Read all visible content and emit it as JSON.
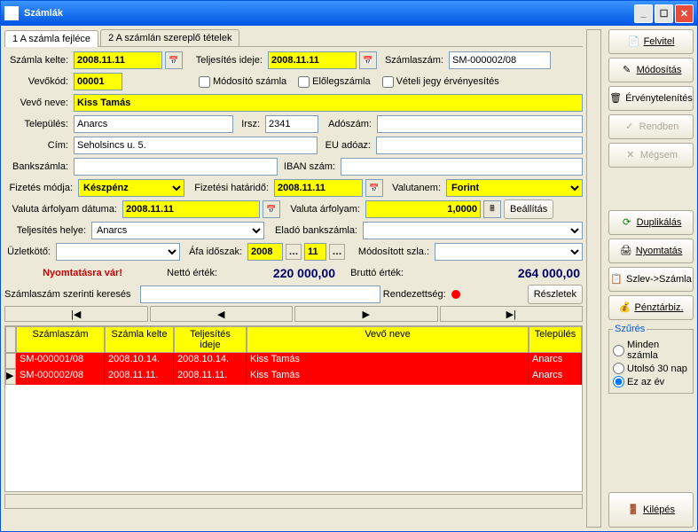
{
  "window": {
    "title": "Számlák"
  },
  "tabs": {
    "t1": "1 A számla fejléce",
    "t2": "2 A számlán szereplő tételek"
  },
  "labels": {
    "szamla_kelte": "Számla kelte:",
    "teljesites_ideje": "Teljesítés ideje:",
    "szamlaszam": "Számlaszám:",
    "vevokod": "Vevőkód:",
    "modosito_szamla": "Módosító számla",
    "elolegszamla": "Előlegszámla",
    "veteli_jegy": "Vételi jegy érvényesítés",
    "vevo_neve": "Vevő neve:",
    "telepules": "Település:",
    "irsz": "Irsz:",
    "adoszam": "Adószám:",
    "cim": "Cím:",
    "eu_adoaz": "EU adóaz:",
    "bankszamla": "Bankszámla:",
    "iban_szam": "IBAN szám:",
    "fizetes_modja": "Fizetés módja:",
    "fizetesi_hatarido": "Fizetési határidő:",
    "valutanem": "Valutanem:",
    "valuta_arfolyam_datuma": "Valuta árfolyam dátuma:",
    "valuta_arfolyam": "Valuta árfolyam:",
    "beallitas": "Beállítás",
    "teljesites_helye": "Teljesítés helye:",
    "elado_bankszamla": "Eladó bankszámla:",
    "uzletkoto": "Üzletkötő:",
    "afa_idoszak": "Áfa időszak:",
    "modositott_szla": "Módosított szla.:",
    "status": "Nyomtatásra vár!",
    "netto_ertek": "Nettó érték:",
    "brutto_ertek": "Bruttó érték:",
    "szamlaszam_kereses": "Számlaszám szerinti keresés",
    "rendezettseg": "Rendezettség:",
    "reszletek": "Részletek"
  },
  "values": {
    "szamla_kelte": "2008.11.11",
    "teljesites_ideje": "2008.11.11",
    "szamlaszam": "SM-000002/08",
    "vevokod": "00001",
    "vevo_neve": "Kiss Tamás",
    "telepules": "Anarcs",
    "irsz": "2341",
    "adoszam": "",
    "cim": "Seholsincs u. 5.",
    "eu_adoaz": "",
    "bankszamla": "",
    "iban_szam": "",
    "fizetes_modja": "Készpénz",
    "fizetesi_hatarido": "2008.11.11",
    "valutanem": "Forint",
    "valuta_arfolyam_datuma": "2008.11.11",
    "valuta_arfolyam": "1,0000",
    "teljesites_helye": "Anarcs",
    "elado_bankszamla": "",
    "uzletkoto": "",
    "afa_ev": "2008",
    "afa_ho": "11",
    "modositott_szla": "",
    "netto_ertek": "220 000,00",
    "brutto_ertek": "264 000,00"
  },
  "grid": {
    "headers": {
      "szamlaszam": "Számlaszám",
      "kelte": "Számla kelte",
      "teljesites": "Teljesítés ideje",
      "vevo": "Vevő neve",
      "telepules": "Település"
    },
    "rows": [
      {
        "szamlaszam": "SM-000001/08",
        "kelte": "2008.10.14.",
        "teljesites": "2008.10.14.",
        "vevo": "Kiss Tamás",
        "telepules": "Anarcs"
      },
      {
        "szamlaszam": "SM-000002/08",
        "kelte": "2008.11.11.",
        "teljesites": "2008.11.11.",
        "vevo": "Kiss Tamás",
        "telepules": "Anarcs"
      }
    ]
  },
  "buttons": {
    "felvitel": "Felvitel",
    "modositas": "Módosítás",
    "ervenytelenites": "Érvénytelenítés",
    "rendben": "Rendben",
    "megsem": "Mégsem",
    "duplikalas": "Duplikálás",
    "nyomtatas": "Nyomtatás",
    "szlev_szamla": "Szlev->Számla",
    "penztarbiz": "Pénztárbiz.",
    "kilepes": "Kilépés"
  },
  "filter": {
    "title": "Szűrés",
    "opt1": "Minden számla",
    "opt2": "Utolsó 30 nap",
    "opt3": "Ez az év"
  }
}
